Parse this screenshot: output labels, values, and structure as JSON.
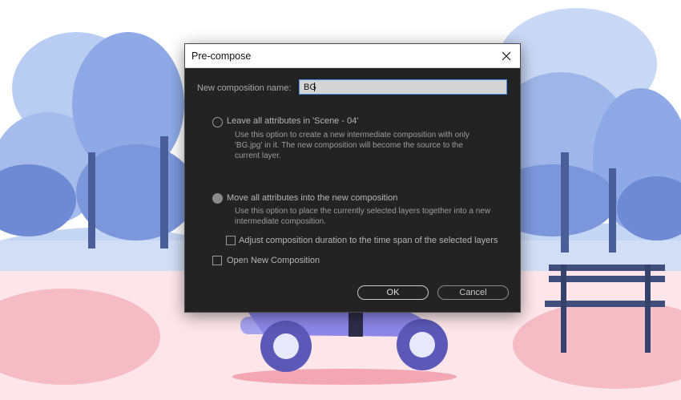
{
  "dialog": {
    "title": "Pre-compose",
    "name_label": "New composition name:",
    "name_value": "BG",
    "option_leave": {
      "label": "Leave all attributes in 'Scene - 04'",
      "desc_line1": "Use this option to create a new intermediate composition with only",
      "desc_line2": "'BG.jpg' in it. The new composition will become the source to the",
      "desc_line3": "current layer."
    },
    "option_move": {
      "label": "Move all attributes into the new composition",
      "desc_line1": "Use this option to place the currently selected layers together into a new",
      "desc_line2": "intermediate composition."
    },
    "adjust_duration_label": "Adjust composition duration to the time span of the selected layers",
    "open_new_label": "Open New Composition",
    "ok_label": "OK",
    "cancel_label": "Cancel"
  },
  "colors": {
    "dialog_bg": "#232323",
    "input_focus": "#4c8ee8",
    "sky": "#ffffff",
    "tree_blue": "#8ba8e6",
    "scooter": "#8b86e8",
    "ground_pink": "#f7d2d8"
  },
  "icons": {
    "close": "close-icon"
  }
}
